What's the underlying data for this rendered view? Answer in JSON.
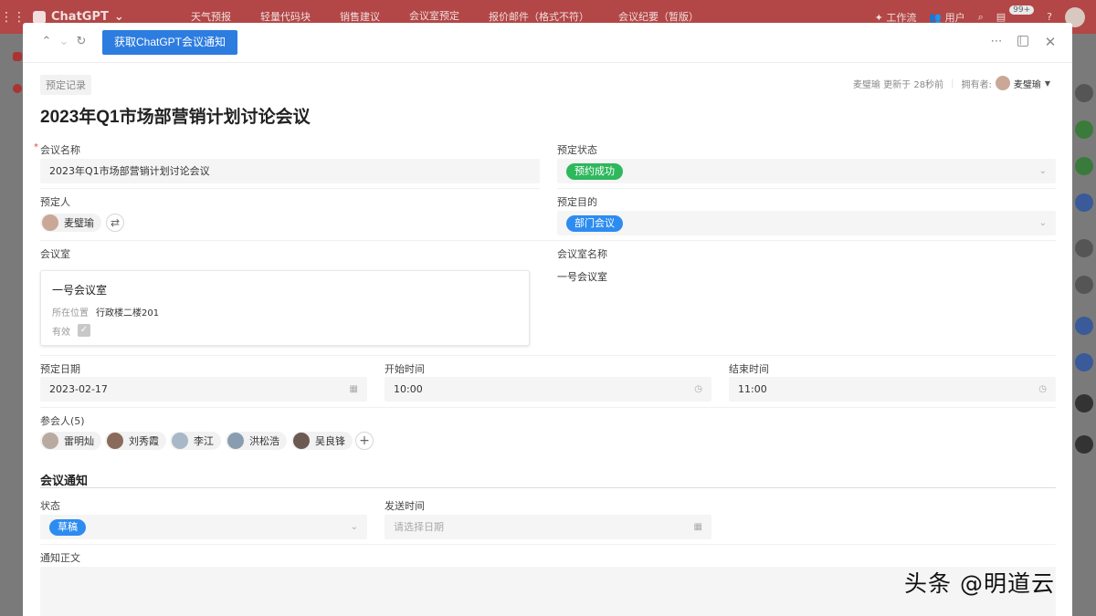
{
  "app": {
    "name": "ChatGPT",
    "tabs": [
      "天气预报",
      "轻量代码块",
      "销售建议",
      "会议室预定",
      "报价邮件（格式不符）",
      "会议纪要（暂版）"
    ],
    "active_tab": "会议室预定",
    "right_items": {
      "workflow": "工作流",
      "users": "用户",
      "badge": "99+"
    }
  },
  "toolbar": {
    "primary_button": "获取ChatGPT会议通知"
  },
  "record": {
    "tag": "预定记录",
    "updated": "麦璧瑜 更新于 28秒前",
    "owner_label": "拥有者:",
    "owner_name": "麦璧瑜",
    "title": "2023年Q1市场部营销计划讨论会议"
  },
  "form": {
    "meeting_name_label": "会议名称",
    "meeting_name_value": "2023年Q1市场部营销计划讨论会议",
    "booking_status_label": "预定状态",
    "booking_status_value": "预约成功",
    "booker_label": "预定人",
    "booker_name": "麦璧瑜",
    "purpose_label": "预定目的",
    "purpose_value": "部门会议",
    "room_label": "会议室",
    "room_card": {
      "name": "一号会议室",
      "location_key": "所在位置",
      "location_value": "行政楼二楼201",
      "valid_key": "有效"
    },
    "room_name_label": "会议室名称",
    "room_name_value": "一号会议室",
    "date_label": "预定日期",
    "date_value": "2023-02-17",
    "start_label": "开始时间",
    "start_value": "10:00",
    "end_label": "结束时间",
    "end_value": "11:00",
    "attendees_label": "参会人(5)",
    "attendees": [
      "雷明灿",
      "刘秀霞",
      "李江",
      "洪松浩",
      "吴良锋"
    ]
  },
  "notice": {
    "section_title": "会议通知",
    "status_label": "状态",
    "status_value": "草稿",
    "send_time_label": "发送时间",
    "send_time_placeholder": "请选择日期",
    "body_label": "通知正文"
  },
  "watermark": "头条 @明道云",
  "colors": {
    "primary": "#2d7de0",
    "success": "#2eb85c",
    "info": "#2d8cf0",
    "topbar": "#b34646"
  }
}
